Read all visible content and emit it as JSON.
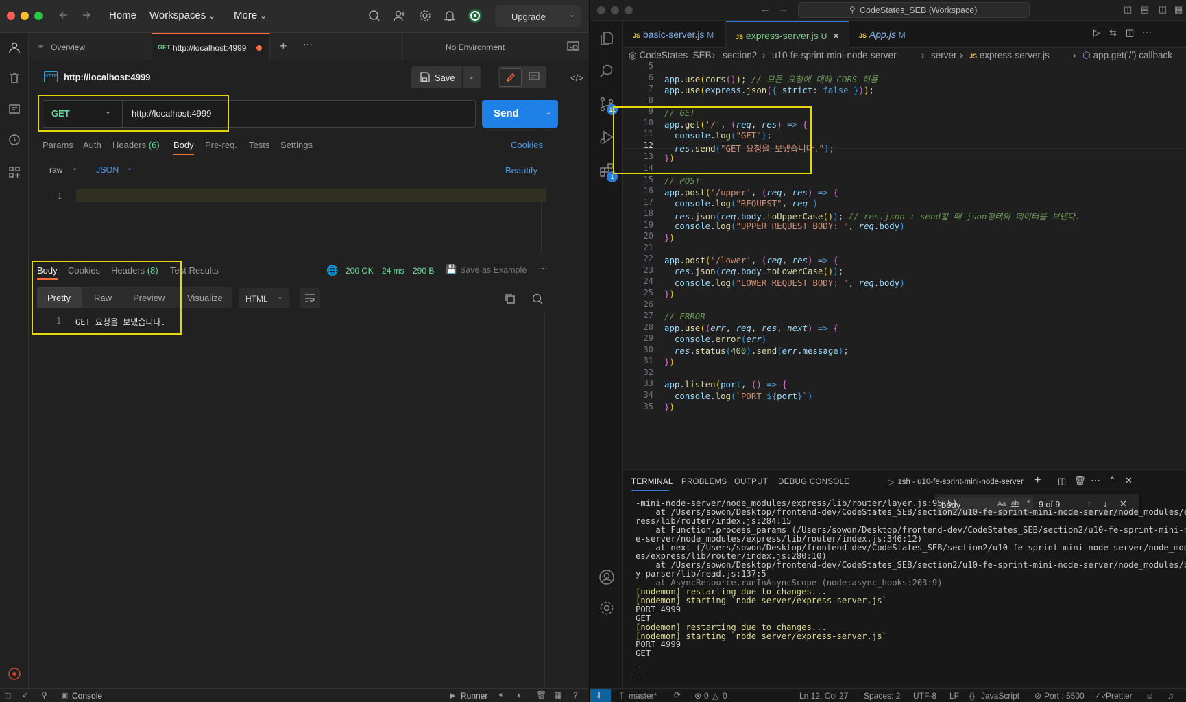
{
  "postman": {
    "nav": {
      "home": "Home",
      "workspaces": "Workspaces",
      "more": "More",
      "upgrade": "Upgrade"
    },
    "tabs": {
      "overview": "Overview",
      "active_method": "GET",
      "active_url": "http://localhost:4999",
      "environment": "No Environment"
    },
    "request": {
      "title": "http://localhost:4999",
      "http_badge": "HTTP",
      "save": "Save",
      "method": "GET",
      "url": "http://localhost:4999",
      "send": "Send",
      "subtabs": [
        "Params",
        "Auth",
        "Headers",
        "(6)",
        "Body",
        "Pre-req.",
        "Tests",
        "Settings"
      ],
      "cookies": "Cookies",
      "body_mode": "raw",
      "body_format": "JSON",
      "beautify": "Beautify",
      "editor_line": "1"
    },
    "response": {
      "tabs": [
        "Body",
        "Cookies",
        "Headers",
        "(8)",
        "Test Results"
      ],
      "status": "200 OK",
      "time": "24 ms",
      "size": "290 B",
      "save_example": "Save as Example",
      "views": [
        "Pretty",
        "Raw",
        "Preview",
        "Visualize"
      ],
      "format": "HTML",
      "line_no": "1",
      "line_text": "GET 요청을 보냈습니다."
    },
    "status": {
      "console": "Console",
      "runner": "Runner"
    }
  },
  "vscode": {
    "title": "CodeStates_SEB (Workspace)",
    "tabs": [
      {
        "name": "basic-server.js",
        "flag": "M"
      },
      {
        "name": "express-server.js",
        "flag": "U"
      },
      {
        "name": "App.js",
        "flag": "M"
      }
    ],
    "breadcrumbs": [
      "CodeStates_SEB",
      "section2",
      "u10-fe-sprint-mini-node-server",
      "server",
      "express-server.js",
      "app.get('/') callback"
    ],
    "badges": {
      "scm": "11",
      "extensions": "1"
    },
    "line_numbers": [
      "5",
      "6",
      "7",
      "8",
      "9",
      "10",
      "11",
      "12",
      "13",
      "14",
      "15",
      "16",
      "17",
      "18",
      "19",
      "20",
      "21",
      "22",
      "23",
      "24",
      "25",
      "26",
      "27",
      "28",
      "29",
      "30",
      "31",
      "32",
      "33",
      "34",
      "35"
    ],
    "panel": {
      "tabs": [
        "TERMINAL",
        "PROBLEMS",
        "OUTPUT",
        "DEBUG CONSOLE"
      ],
      "terminal_name": "zsh - u10-fe-sprint-mini-node-server",
      "find_query": "body",
      "find_count": "9 of 9",
      "lines": [
        "-mini-node-server/node_modules/express/lib/router/layer.js:95:5)",
        "    at /Users/sowon/Desktop/frontend-dev/CodeStates_SEB/section2/u10-fe-sprint-mini-node-server/node_modules/exp",
        "ress/lib/router/index.js:284:15",
        "    at Function.process_params (/Users/sowon/Desktop/frontend-dev/CodeStates_SEB/section2/u10-fe-sprint-mini-nod",
        "e-server/node_modules/express/lib/router/index.js:346:12)",
        "    at next (/Users/sowon/Desktop/frontend-dev/CodeStates_SEB/section2/u10-fe-sprint-mini-node-server/node_modul",
        "es/express/lib/router/index.js:280:10)",
        "    at /Users/sowon/Desktop/frontend-dev/CodeStates_SEB/section2/u10-fe-sprint-mini-node-server/node_modules/bod",
        "y-parser/lib/read.js:137:5",
        "    at AsyncResource.runInAsyncScope (node:async_hooks:203:9)",
        "[nodemon] restarting due to changes...",
        "[nodemon] starting `node server/express-server.js`",
        "PORT 4999",
        "GET",
        "[nodemon] restarting due to changes...",
        "[nodemon] starting `node server/express-server.js`",
        "PORT 4999",
        "GET"
      ]
    },
    "status": {
      "branch": "master*",
      "errors": "0",
      "warnings": "0",
      "position": "Ln 12, Col 27",
      "spaces": "Spaces: 2",
      "encoding": "UTF-8",
      "eol": "LF",
      "language": "JavaScript",
      "port": "Port : 5500",
      "prettier": "Prettier"
    }
  },
  "colors": {
    "accent": "#1f80e8",
    "orange": "#ff6c37",
    "highlight": "#e4d80a",
    "get_green": "#6bdd9a"
  }
}
